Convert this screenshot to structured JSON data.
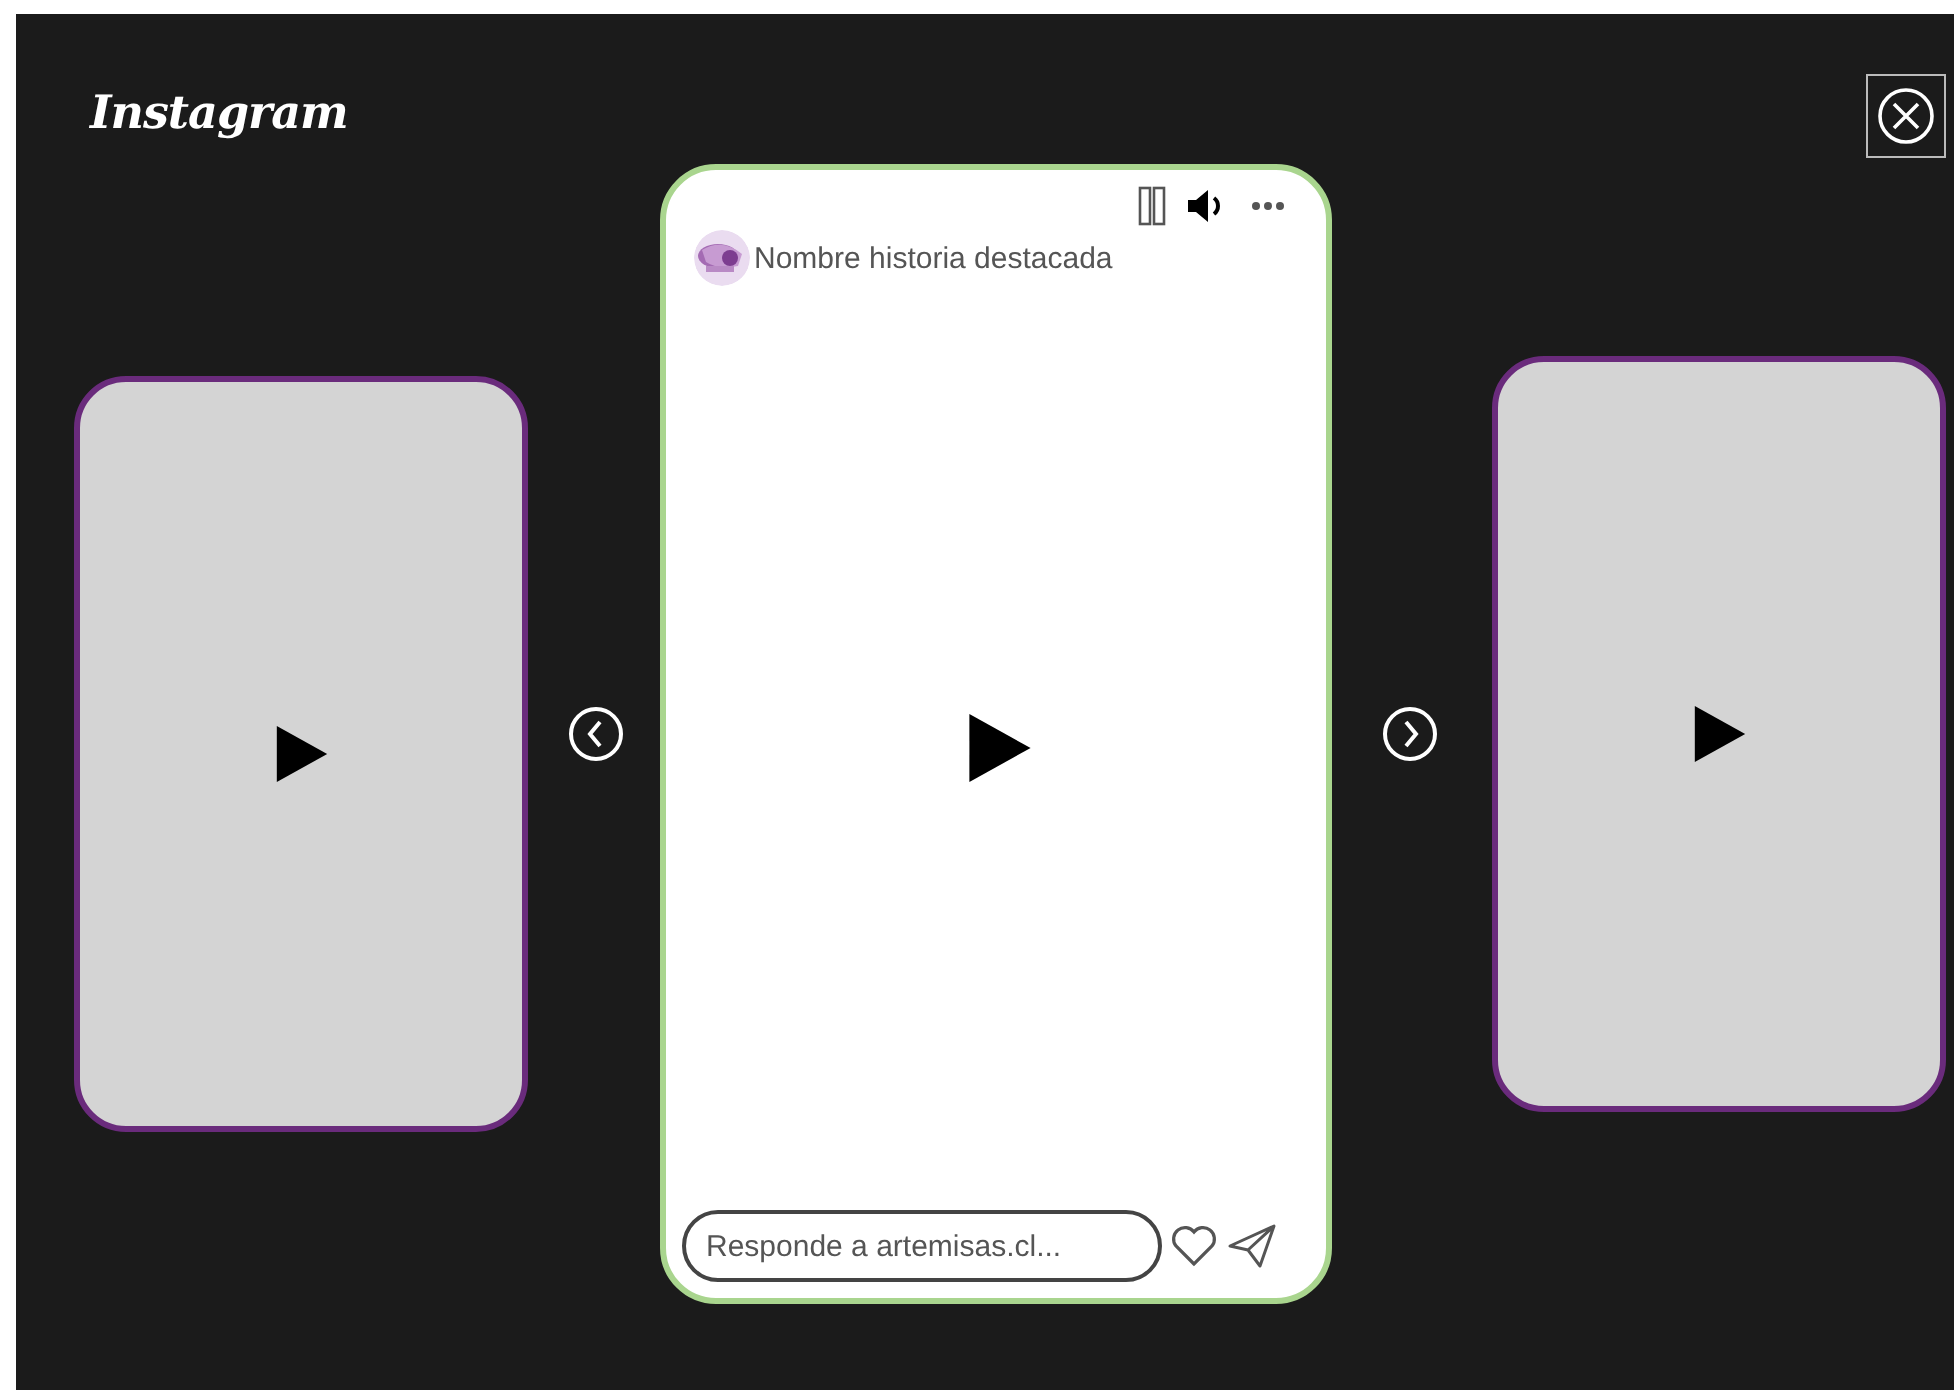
{
  "header": {
    "logo": "Instagram"
  },
  "stories": [
    {
      "kind": "preview"
    },
    {
      "kind": "current",
      "title": "Nombre historia destacada",
      "reply": {
        "placeholder": "Responde a artemisas.cl..."
      }
    },
    {
      "kind": "preview"
    }
  ]
}
